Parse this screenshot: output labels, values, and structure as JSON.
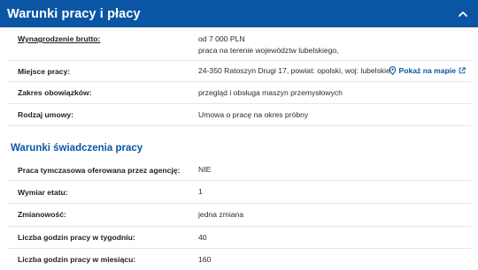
{
  "header": {
    "title": "Warunki pracy i płacy"
  },
  "rows1": [
    {
      "label": "Wynagrodzenie brutto:",
      "value1": "od 7 000 PLN",
      "value2": "praca na terenie województw lubelskiego,"
    },
    {
      "label": "Miejsce pracy:",
      "value1": "24-350 Ratoszyn Drugi 17, powiat: opolski, woj: lubelskie",
      "link": "Pokaż na mapie"
    },
    {
      "label": "Zakres obowiązków:",
      "value1": "przegląd i obsługa maszyn przemysłowych"
    },
    {
      "label": "Rodzaj umowy:",
      "value1": "Umowa o pracę na okres próbny"
    }
  ],
  "section2": {
    "title": "Warunki świadczenia pracy"
  },
  "rows2": [
    {
      "label": "Praca tymczasowa oferowana przez agencję:",
      "value1": "NIE"
    },
    {
      "label": "Wymiar etatu:",
      "value1": "1"
    },
    {
      "label": "Zmianowość:",
      "value1": "jedna zmiana"
    },
    {
      "label": "Liczba godzin pracy w tygodniu:",
      "value1": "40"
    },
    {
      "label": "Liczba godzin pracy w miesiącu:",
      "value1": "160"
    }
  ],
  "colors": {
    "header_bg": "#0b56a4",
    "accent": "#0b56a4"
  }
}
